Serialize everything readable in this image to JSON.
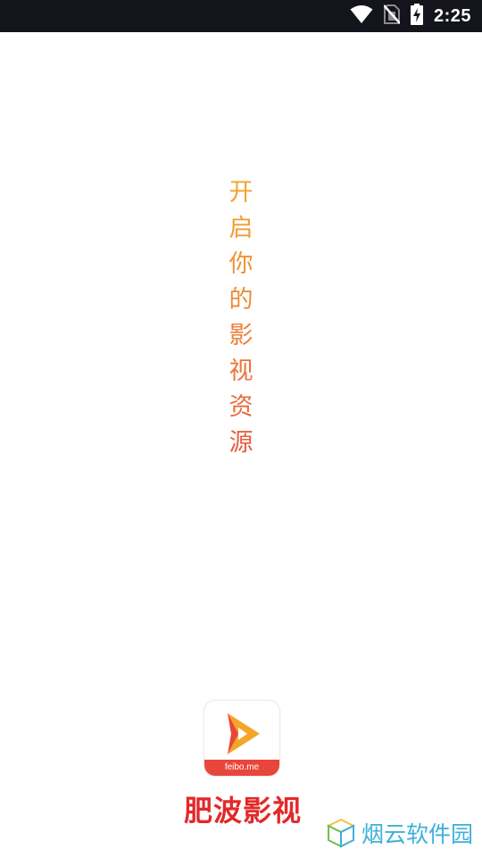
{
  "status_bar": {
    "time": "2:25",
    "icons": [
      "wifi-icon",
      "no-sim-icon",
      "battery-charging-icon"
    ]
  },
  "splash": {
    "slogan_chars": [
      "开",
      "启",
      "你",
      "的",
      "影",
      "视",
      "资",
      "源"
    ],
    "slogan_colors": [
      "#f2a431",
      "#f29c33",
      "#f09335",
      "#ee8a37",
      "#ec7f39",
      "#ea753a",
      "#e86a3c",
      "#e65f3e"
    ],
    "app_name": "肥波影视",
    "logo_domain": "feibo.me"
  },
  "watermark": {
    "text": "烟云软件园",
    "icon": "cube-icon"
  },
  "colors": {
    "status_bar_bg": "#14141c",
    "app_name": "#e32929",
    "logo_red": "#e8463a",
    "logo_orange": "#f4a52a",
    "watermark": "#3fb0d8"
  }
}
